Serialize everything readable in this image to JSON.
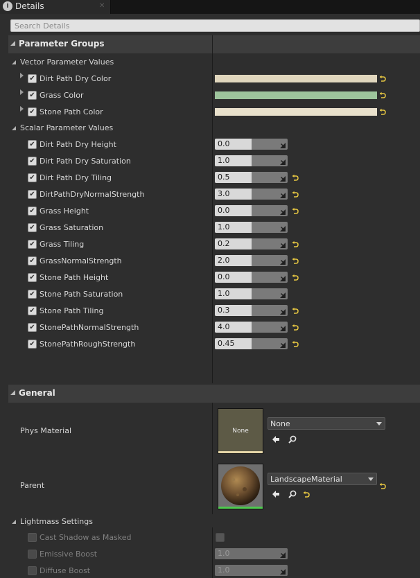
{
  "tab": {
    "title": "Details",
    "close": "✕"
  },
  "search": {
    "placeholder": "Search Details"
  },
  "categories": {
    "parameter_groups": "Parameter Groups",
    "general": "General"
  },
  "subcategories": {
    "vector": "Vector Parameter Values",
    "scalar": "Scalar Parameter Values",
    "lightmass": "Lightmass Settings"
  },
  "vector_params": [
    {
      "label": "Dirt Path Dry Color",
      "color": "#e0d6bd"
    },
    {
      "label": "Grass Color",
      "color": "#9dc49c"
    },
    {
      "label": "Stone Path Color",
      "color": "#e9e1cc"
    }
  ],
  "scalar_params": [
    {
      "label": "Dirt Path Dry Height",
      "value": "0.0",
      "reset": false
    },
    {
      "label": "Dirt Path Dry Saturation",
      "value": "1.0",
      "reset": false
    },
    {
      "label": "Dirt Path Dry Tiling",
      "value": "0.5",
      "reset": true
    },
    {
      "label": "DirtPathDryNormalStrength",
      "value": "3.0",
      "reset": true
    },
    {
      "label": "Grass Height",
      "value": "0.0",
      "reset": true
    },
    {
      "label": "Grass Saturation",
      "value": "1.0",
      "reset": false
    },
    {
      "label": "Grass Tiling",
      "value": "0.2",
      "reset": true
    },
    {
      "label": "GrassNormalStrength",
      "value": "2.0",
      "reset": true
    },
    {
      "label": "Stone Path Height",
      "value": "0.0",
      "reset": true
    },
    {
      "label": "Stone Path Saturation",
      "value": "1.0",
      "reset": false
    },
    {
      "label": "Stone Path Tiling",
      "value": "0.3",
      "reset": true
    },
    {
      "label": "StonePathNormalStrength",
      "value": "4.0",
      "reset": true
    },
    {
      "label": "StonePathRoughStrength",
      "value": "0.45",
      "reset": true
    }
  ],
  "general": {
    "phys_material": {
      "label": "Phys Material",
      "thumb_text": "None",
      "value": "None"
    },
    "parent": {
      "label": "Parent",
      "value": "LandscapeMaterial"
    }
  },
  "lightmass": [
    {
      "label": "Cast Shadow as Masked",
      "kind": "checkbox"
    },
    {
      "label": "Emissive Boost",
      "kind": "number",
      "value": "1.0"
    },
    {
      "label": "Diffuse Boost",
      "kind": "number",
      "value": "1.0"
    }
  ],
  "colors": {
    "reset_arrow": "#e8c842",
    "parent_bar": "#4ec94e",
    "phys_bar": "#e6d7a8"
  },
  "icons": {
    "tab": "info-icon",
    "use_selected": "arrow-left-icon",
    "browse": "search-icon",
    "reset": "reset-to-default-icon",
    "drag": "drag-grip-icon",
    "dropdown": "chevron-down-icon"
  }
}
